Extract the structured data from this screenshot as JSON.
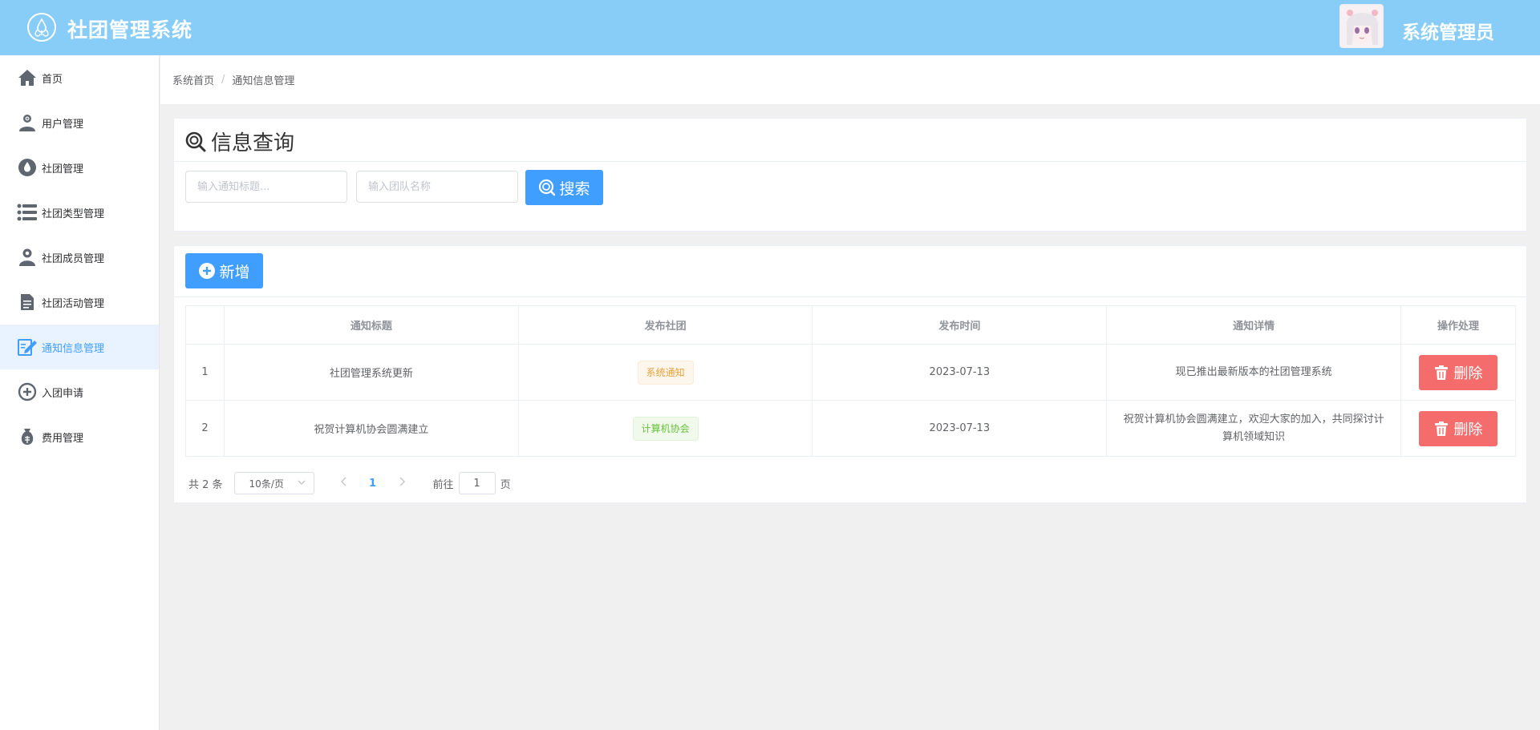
{
  "header": {
    "app_title": "社团管理系统",
    "admin_name": "系统管理员",
    "colors": {
      "header_bg": "#87cdf8",
      "primary": "#409eff",
      "danger": "#f56c6c"
    }
  },
  "sidebar": {
    "items": [
      {
        "label": "首页",
        "icon": "home-icon"
      },
      {
        "label": "用户管理",
        "icon": "user-add-icon"
      },
      {
        "label": "社团管理",
        "icon": "water-drop-icon"
      },
      {
        "label": "社团类型管理",
        "icon": "list-icon"
      },
      {
        "label": "社团成员管理",
        "icon": "person-icon"
      },
      {
        "label": "社团活动管理",
        "icon": "document-icon"
      },
      {
        "label": "通知信息管理",
        "icon": "edit-icon",
        "active": true
      },
      {
        "label": "入团申请",
        "icon": "circle-plus-icon"
      },
      {
        "label": "费用管理",
        "icon": "money-bag-icon"
      }
    ]
  },
  "breadcrumb": {
    "home": "系统首页",
    "current": "通知信息管理",
    "separator": "/"
  },
  "search": {
    "title": "信息查询",
    "title_placeholder": "输入通知标题...",
    "team_placeholder": "输入团队名称",
    "search_label": "搜索"
  },
  "table": {
    "add_label": "新增",
    "columns": [
      "",
      "通知标题",
      "发布社团",
      "发布时间",
      "通知详情",
      "操作处理"
    ],
    "rows": [
      {
        "index": "1",
        "title": "社团管理系统更新",
        "club": "系统通知",
        "club_tag": "orange",
        "time": "2023-07-13",
        "detail": "现已推出最新版本的社团管理系统",
        "action": "删除"
      },
      {
        "index": "2",
        "title": "祝贺计算机协会圆满建立",
        "club": "计算机协会",
        "club_tag": "green",
        "time": "2023-07-13",
        "detail": "祝贺计算机协会圆满建立，欢迎大家的加入，共同探讨计算机领域知识",
        "action": "删除"
      }
    ]
  },
  "pagination": {
    "total_text": "共 2 条",
    "page_size": "10条/页",
    "current_page": "1",
    "goto_prefix": "前往",
    "goto_value": "1",
    "goto_suffix": "页"
  }
}
